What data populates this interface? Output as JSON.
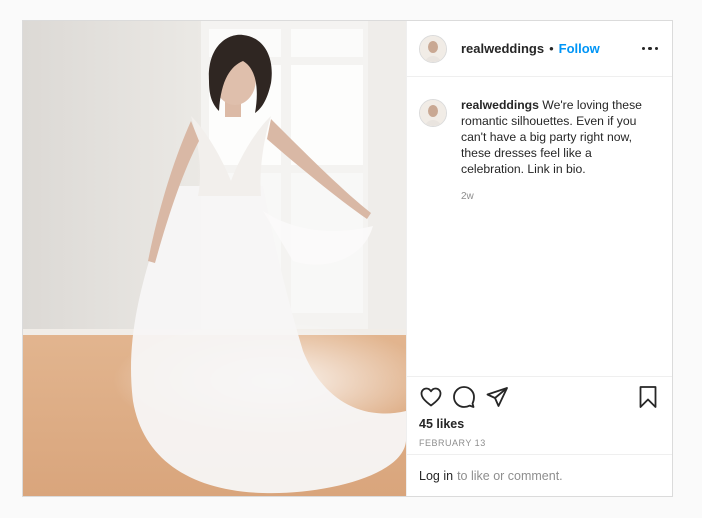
{
  "post": {
    "username": "realweddings",
    "separator": "•",
    "follow_label": "Follow",
    "more_icon": "more-horizontal-icon",
    "caption": {
      "username": "realweddings",
      "text": "We're loving these romantic silhouettes. Even if you can't have a big party right now, these dresses feel like a celebration. Link in bio.",
      "time": "2w"
    },
    "actions": {
      "like_icon": "heart-icon",
      "comment_icon": "comment-icon",
      "share_icon": "share-icon",
      "save_icon": "bookmark-icon"
    },
    "likes": "45 likes",
    "date": "FEBRUARY 13",
    "login_prompt": {
      "link_label": "Log in",
      "rest_text": "to like or comment."
    }
  },
  "colors": {
    "follow": "#0095f6",
    "text": "#262626",
    "muted": "#8e8e8e",
    "border": "#dbdbdb"
  }
}
